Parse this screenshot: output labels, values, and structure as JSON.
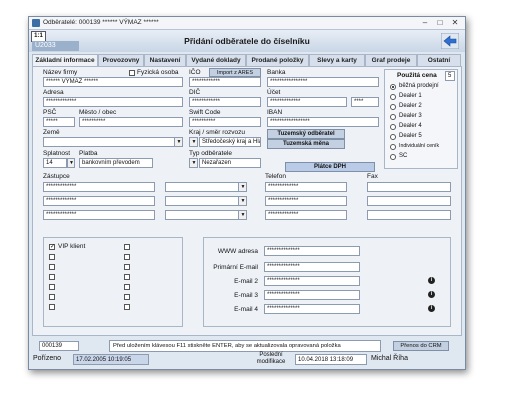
{
  "window": {
    "title": "Odběratelé: 000139  ****** VÝMAZ ******"
  },
  "header": {
    "tag": "1:1",
    "logo_text": "U2033",
    "title": "Přidání odběratele do číselníku"
  },
  "tabs": [
    "Základní informace",
    "Provozovny",
    "Nastavení",
    "Vydané doklady",
    "Prodané položky",
    "Slevy a karty",
    "Graf prodeje",
    "Ostatní"
  ],
  "form": {
    "nazev_label": "Název firmy",
    "nazev_value": "****** VÝMAZ ******",
    "fyzicka_label": "Fyzická osoba",
    "ico_label": "IČO",
    "ico_value": "************",
    "import_ares": "Import z ARES",
    "banka_label": "Banka",
    "banka_value": "****************",
    "adresa_label": "Adresa",
    "adresa_value": "*************",
    "dic_label": "DIČ",
    "dic_value": "************",
    "ucet_label": "Účet",
    "ucet_value": "*************",
    "ucet_code": "****",
    "psc_label": "PSČ",
    "psc_value": "*****",
    "mesto_label": "Město / obec",
    "mesto_value": "**********",
    "swift_label": "Swift Code",
    "swift_value": "**********",
    "iban_label": "IBAN",
    "iban_value": "*****************",
    "zeme_label": "Země",
    "kraj_label": "Kraj  / směr rozvozu",
    "kraj_value": "Středočeský kraj a Hlavní",
    "tuzemsky_odb": "Tuzemský odběratel",
    "tuzemska_mena": "Tuzemská měna",
    "splatnost_label": "Splatnost",
    "splatnost_value": "14",
    "platba_label": "Platba",
    "platba_value": "bankovním převodem",
    "typ_label": "Typ odběratele",
    "typ_value": "Nezařazen",
    "platce_dph": "Plátce DPH",
    "zastupce_label": "Zástupce",
    "telefon_label": "Telefon",
    "fax_label": "Fax",
    "masked": "*************"
  },
  "price_group": {
    "title": "Použitá cena",
    "value": "5",
    "options": [
      "běžná prodejní",
      "Dealer 1",
      "Dealer 2",
      "Dealer 3",
      "Dealer 4",
      "Dealer 5",
      "Individuální ceník",
      "SC"
    ]
  },
  "vip": {
    "label": "VIP klient"
  },
  "contacts": {
    "www_label": "WWW adresa",
    "primary_email_label": "Primární E-mail",
    "email2_label": "E-mail 2",
    "email3_label": "E-mail 3",
    "email4_label": "E-mail 4",
    "masked": "**************"
  },
  "footer": {
    "id_value": "000139",
    "message": "Před uložením klávesou F11 stiskněte ENTER, aby se aktualizovala opravovaná položka",
    "crm_button": "Přenos do CRM",
    "created_label": "Pořízeno",
    "created_value": "17.02.2005 10:19:05",
    "modified_label": "Poslední modifikace",
    "modified_value": "10.04.2018 13:18:09",
    "modified_by": "Michal Říha"
  }
}
